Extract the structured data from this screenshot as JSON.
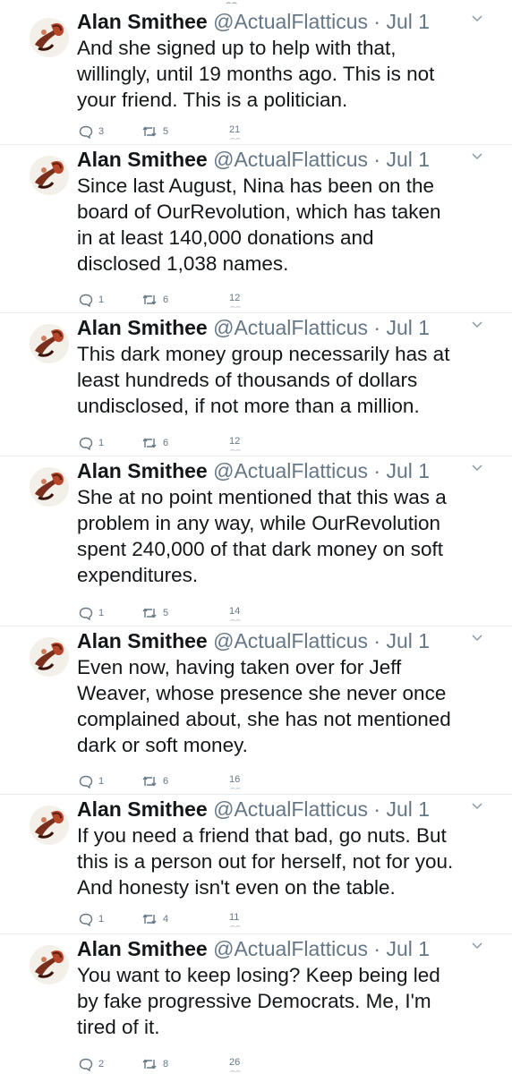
{
  "author": {
    "name": "Alan Smithee",
    "handle": "@ActualFlatticus",
    "separator": "·",
    "date": "Jul 1"
  },
  "icons": {
    "avatar": "pipe-avatar-icon",
    "caret": "chevron-down-icon",
    "reply": "reply-bubble-icon",
    "retweet": "retweet-icon",
    "like": "heart-icon"
  },
  "colors": {
    "text": "#14171a",
    "secondary": "#657786",
    "border": "#e6ecf0"
  },
  "tweets": [
    {
      "text": "And she signed up to help with that,\nwillingly, until 19 months ago.  This is not\nyour friend.  This is a politician.",
      "replies": "3",
      "retweets": "5",
      "likes": "21"
    },
    {
      "text": "Since last August, Nina has been on the\nboard of OurRevolution, which has taken\nin at least 140,000 donations and\ndisclosed 1,038 names.",
      "replies": "1",
      "retweets": "6",
      "likes": "12"
    },
    {
      "text": "This dark money group necessarily has at\nleast hundreds of thousands of dollars\nundisclosed, if not more than a million.",
      "replies": "1",
      "retweets": "6",
      "likes": "12"
    },
    {
      "text": "She at no point mentioned that this was a\nproblem in any way, while OurRevolution\nspent 240,000 of that dark money on soft\nexpenditures.",
      "replies": "1",
      "retweets": "5",
      "likes": "14"
    },
    {
      "text": "Even now, having taken over for Jeff\nWeaver, whose presence she never once\ncomplained about, she has not mentioned\ndark or soft money.",
      "replies": "1",
      "retweets": "6",
      "likes": "16"
    },
    {
      "text": "If you need a friend that bad, go nuts.  But\nthis is a person out for herself, not for you.\nAnd honesty isn't even on the table.",
      "replies": "1",
      "retweets": "4",
      "likes": "11"
    },
    {
      "text": "You want to keep losing?  Keep being led\nby fake progressive Democrats.  Me, I'm\ntired of it.",
      "replies": "2",
      "retweets": "8",
      "likes": "26"
    }
  ]
}
